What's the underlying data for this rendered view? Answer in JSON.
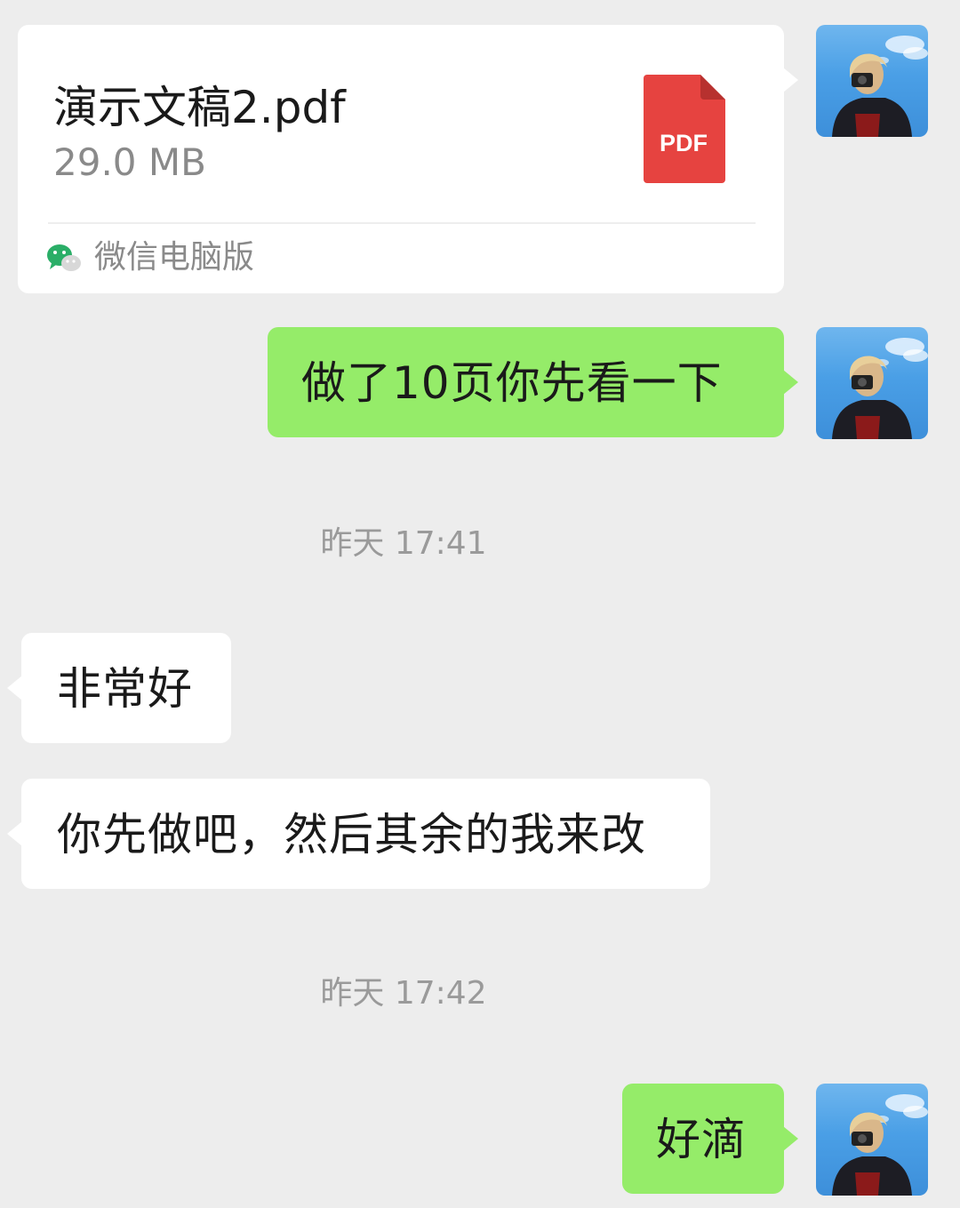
{
  "file_card": {
    "name": "演示文稿2.pdf",
    "size": "29.0 MB",
    "type_label": "PDF",
    "source": "微信电脑版"
  },
  "messages": [
    {
      "side": "right",
      "text": "做了10页你先看一下"
    },
    {
      "side": "left",
      "text": "非常好"
    },
    {
      "side": "left",
      "text": "你先做吧，然后其余的我来改"
    },
    {
      "side": "right",
      "text": "好滴"
    }
  ],
  "timestamps": [
    "昨天 17:41",
    "昨天 17:42"
  ],
  "colors": {
    "background": "#ededed",
    "self_bubble": "#95ec69",
    "other_bubble": "#ffffff",
    "pdf_red": "#e64340"
  }
}
